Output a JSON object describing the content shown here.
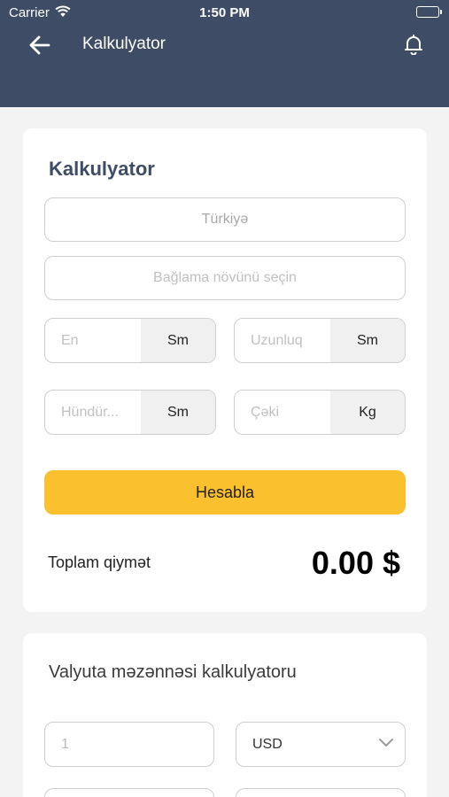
{
  "status_bar": {
    "carrier": "Carrier",
    "time": "1:50 PM"
  },
  "nav": {
    "title": "Kalkulyator",
    "back_icon": "arrow-left-icon",
    "bell_icon": "bell-icon"
  },
  "calculator": {
    "title": "Kalkulyator",
    "country_value": "Türkiyə",
    "package_placeholder": "Bağlama növünü seçin",
    "width": {
      "placeholder": "En",
      "unit": "Sm"
    },
    "length": {
      "placeholder": "Uzunluq",
      "unit": "Sm"
    },
    "height": {
      "placeholder": "Hündür...",
      "unit": "Sm"
    },
    "weight": {
      "placeholder": "Çəki",
      "unit": "Kg"
    },
    "button_label": "Hesabla",
    "total_label": "Toplam qiymət",
    "total_value": "0.00 $"
  },
  "currency": {
    "title": "Valyuta məzənnəsi kalkulyatoru",
    "amount_placeholder": "1",
    "from_currency": "USD"
  },
  "colors": {
    "header": "#3e4c66",
    "accent": "#fbc02d"
  }
}
